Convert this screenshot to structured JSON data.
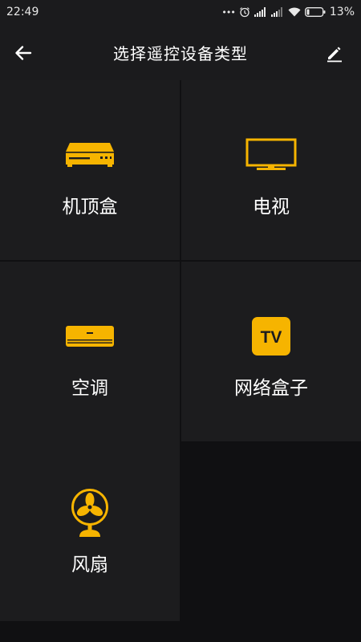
{
  "status_bar": {
    "time": "22:49",
    "dots": "•••",
    "battery": "13%"
  },
  "header": {
    "title": "选择遥控设备类型"
  },
  "devices": [
    {
      "label": "机顶盒",
      "icon": "set-top-box-icon"
    },
    {
      "label": "电视",
      "icon": "tv-icon"
    },
    {
      "label": "空调",
      "icon": "air-conditioner-icon"
    },
    {
      "label": "网络盒子",
      "icon": "network-box-icon",
      "icon_text": "TV"
    },
    {
      "label": "风扇",
      "icon": "fan-icon"
    }
  ],
  "colors": {
    "accent": "#f6b400",
    "tile_bg": "#1c1c1e",
    "page_bg": "#101012",
    "bar_bg": "#1b1b1d"
  }
}
